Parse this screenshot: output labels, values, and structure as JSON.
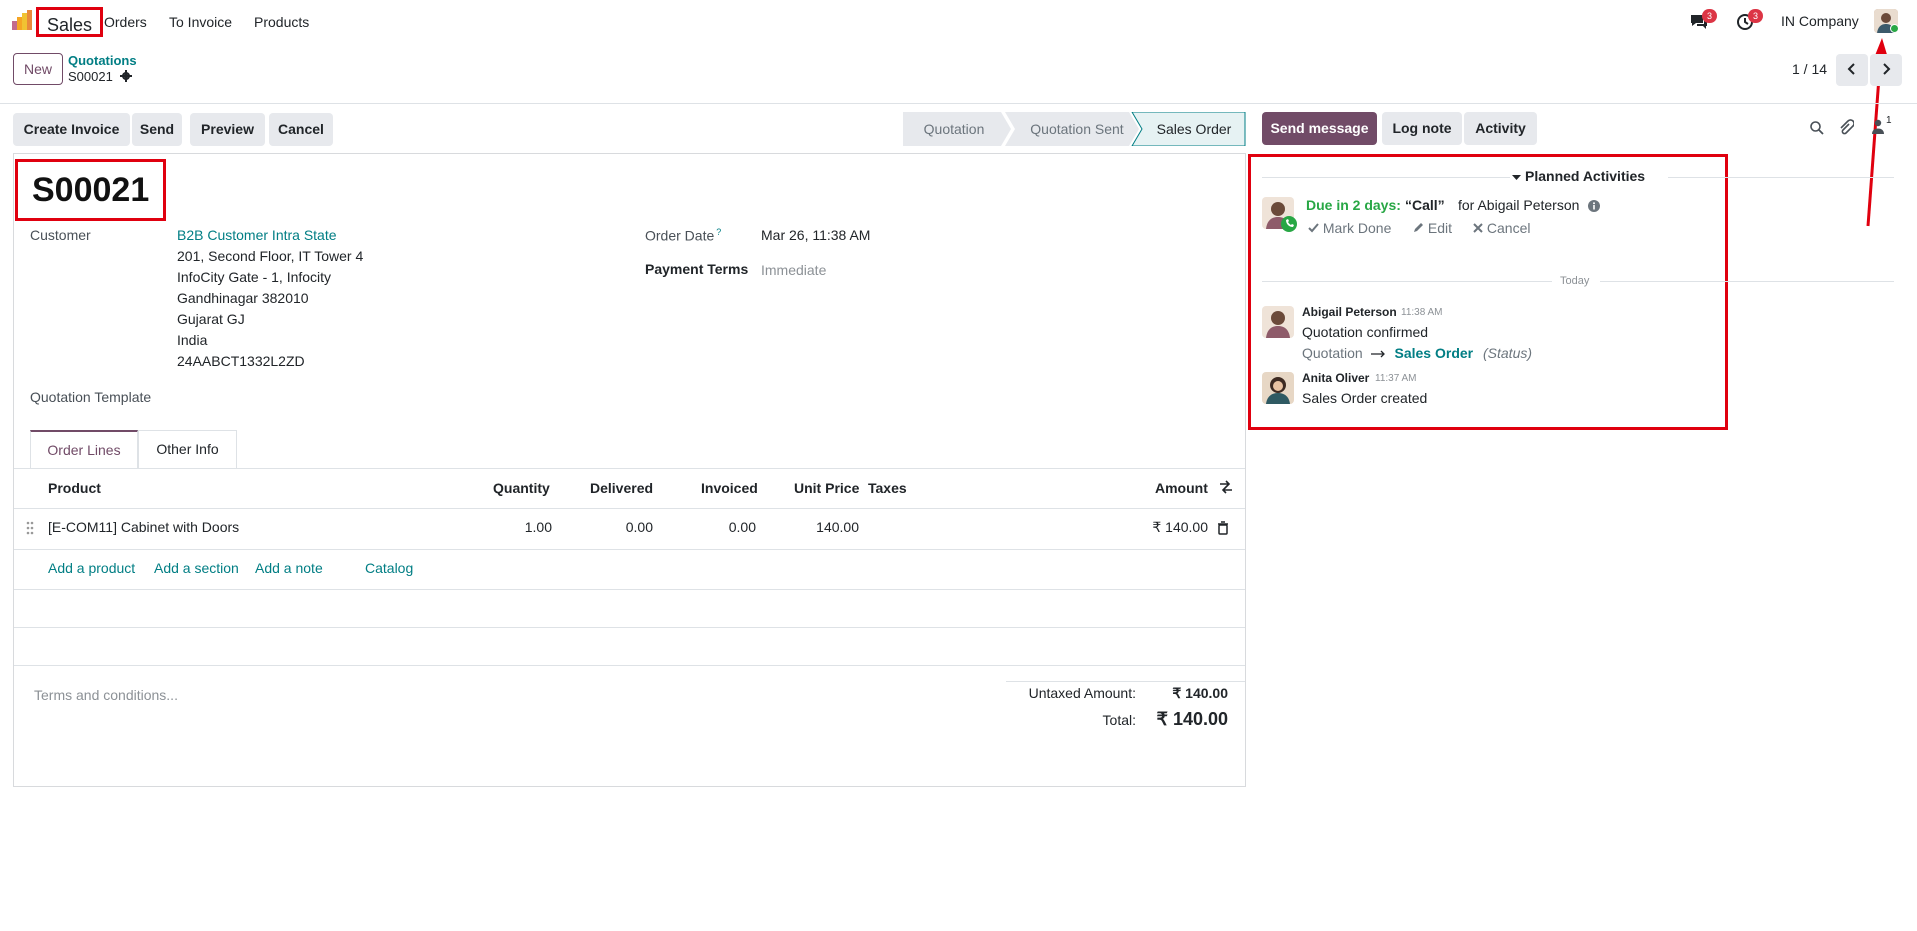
{
  "nav": {
    "app": "Sales",
    "menu": [
      "Orders",
      "To Invoice",
      "Products"
    ],
    "messages_count": "3",
    "activities_count": "3",
    "company": "IN Company"
  },
  "control": {
    "new_label": "New",
    "breadcrumb_parent": "Quotations",
    "breadcrumb_current": "S00021",
    "pager": "1 / 14"
  },
  "actions": [
    "Create Invoice",
    "Send",
    "Preview",
    "Cancel"
  ],
  "stages": [
    "Quotation",
    "Quotation Sent",
    "Sales Order"
  ],
  "form": {
    "name": "S00021",
    "customer_label": "Customer",
    "customer_name": "B2B Customer Intra State",
    "address_lines": [
      "201, Second Floor, IT Tower 4",
      "InfoCity Gate - 1, Infocity",
      "Gandhinagar 382010",
      "Gujarat GJ",
      "India",
      "24AABCT1332L2ZD"
    ],
    "order_date_label": "Order Date",
    "order_date_help": "?",
    "order_date": "Mar 26, 11:38 AM",
    "payment_terms_label": "Payment Terms",
    "payment_terms": "Immediate",
    "template_label": "Quotation Template"
  },
  "tabs": [
    "Order Lines",
    "Other Info"
  ],
  "lines": {
    "headers": [
      "Product",
      "Quantity",
      "Delivered",
      "Invoiced",
      "Unit Price",
      "Taxes",
      "Amount"
    ],
    "rows": [
      {
        "product": "[E-COM11] Cabinet with Doors",
        "quantity": "1.00",
        "delivered": "0.00",
        "invoiced": "0.00",
        "unit_price": "140.00",
        "taxes": "",
        "amount": "₹ 140.00"
      }
    ],
    "add_links": [
      "Add a product",
      "Add a section",
      "Add a note",
      "Catalog"
    ]
  },
  "footer": {
    "terms_placeholder": "Terms and conditions...",
    "untaxed_label": "Untaxed Amount:",
    "untaxed_value": "₹ 140.00",
    "total_label": "Total:",
    "total_value": "₹ 140.00"
  },
  "chatter": {
    "buttons": [
      "Send message",
      "Log note",
      "Activity"
    ],
    "followers_count": "1",
    "planned_title": "Planned Activities",
    "activity": {
      "due": "Due in 2 days:",
      "summary": "“Call”",
      "for": "for Abigail Peterson",
      "mark_done": "Mark Done",
      "edit": "Edit",
      "cancel": "Cancel"
    },
    "today_label": "Today",
    "messages": [
      {
        "author": "Abigail Peterson",
        "time": "11:38 AM",
        "body": "Quotation confirmed",
        "tracking_old": "Quotation",
        "tracking_new": "Sales Order",
        "tracking_field": "(Status)"
      },
      {
        "author": "Anita Oliver",
        "time": "11:37 AM",
        "body": "Sales Order created"
      }
    ]
  },
  "colors": {
    "brand": "#714b67",
    "link": "#017e84",
    "highlight": "#e0000f",
    "due": "#28a745"
  }
}
